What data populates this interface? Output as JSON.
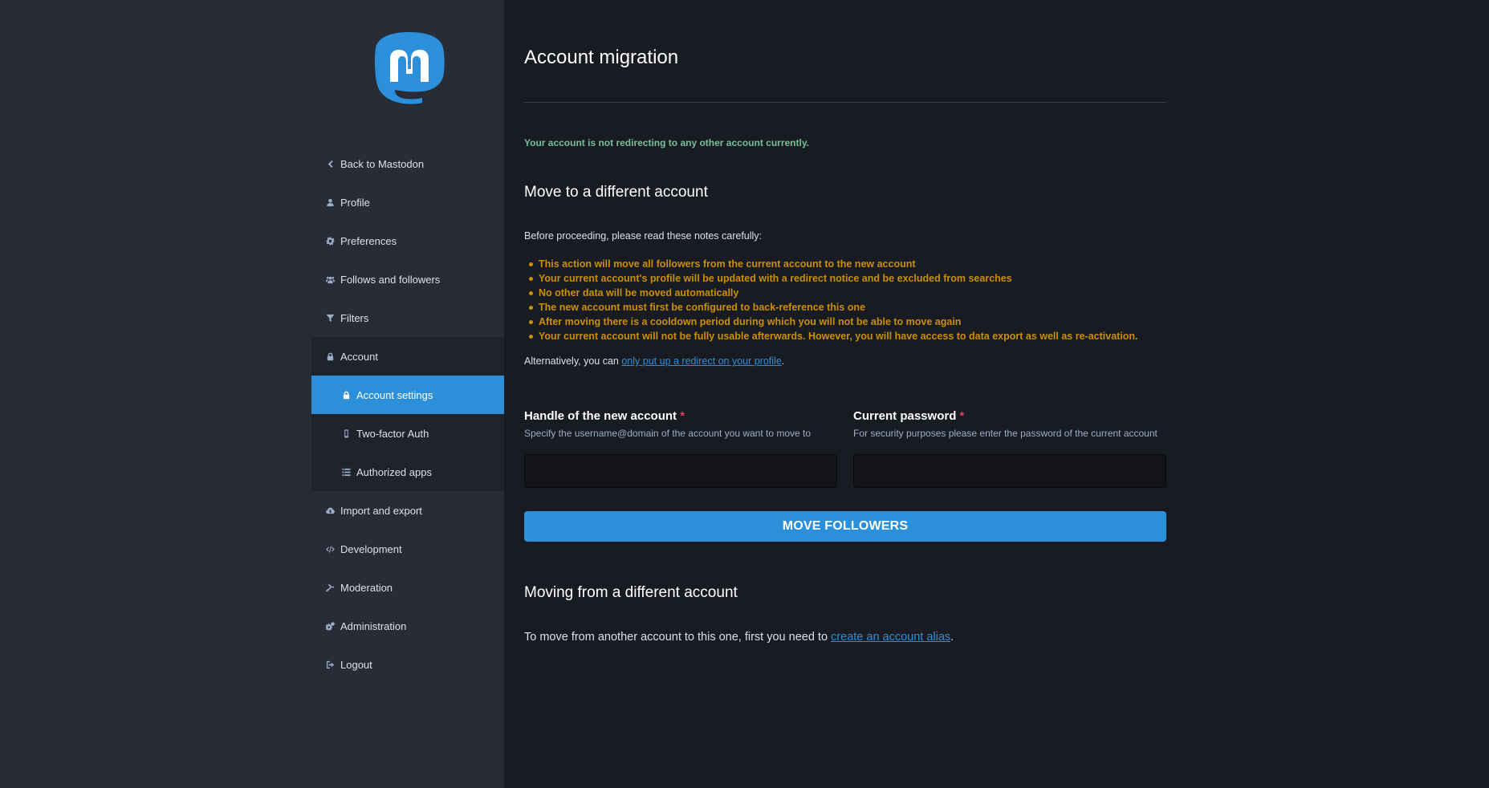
{
  "app": {
    "title": "Account migration",
    "colors": {
      "accent": "#2b90d9",
      "sidebar_bg": "#282c37",
      "content_bg": "#191b22",
      "success": "#79bd9a",
      "warning": "#ca8f04",
      "required": "#df405a"
    }
  },
  "sidebar": {
    "logo_icon": "mastodon-logo",
    "items": [
      {
        "label": "Back to Mastodon",
        "icon": "chevron-left-icon"
      },
      {
        "label": "Profile",
        "icon": "user-icon"
      },
      {
        "label": "Preferences",
        "icon": "gear-icon"
      },
      {
        "label": "Follows and followers",
        "icon": "users-icon"
      },
      {
        "label": "Filters",
        "icon": "filter-icon"
      },
      {
        "label": "Account",
        "icon": "lock-icon"
      },
      {
        "label": "Account settings",
        "icon": "lock-icon",
        "active": true
      },
      {
        "label": "Two-factor Auth",
        "icon": "mobile-icon"
      },
      {
        "label": "Authorized apps",
        "icon": "list-icon"
      },
      {
        "label": "Import and export",
        "icon": "cloud-download-icon"
      },
      {
        "label": "Development",
        "icon": "code-icon"
      },
      {
        "label": "Moderation",
        "icon": "gavel-icon"
      },
      {
        "label": "Administration",
        "icon": "cogs-icon"
      },
      {
        "label": "Logout",
        "icon": "sign-out-icon"
      }
    ]
  },
  "main": {
    "status_note": "Your account is not redirecting to any other account currently.",
    "move_section": {
      "heading": "Move to a different account",
      "intro": "Before proceeding, please read these notes carefully:",
      "notes": [
        "This action will move all followers from the current account to the new account",
        "Your current account's profile will be updated with a redirect notice and be excluded from searches",
        "No other data will be moved automatically",
        "The new account must first be configured to back-reference this one",
        "After moving there is a cooldown period during which you will not be able to move again",
        "Your current account will not be fully usable afterwards. However, you will have access to data export as well as re-activation."
      ],
      "alt_prefix": "Alternatively, you can ",
      "alt_link": "only put up a redirect on your profile",
      "alt_suffix": "."
    },
    "form": {
      "handle_label": "Handle of the new account",
      "handle_hint": "Specify the username@domain of the account you want to move to",
      "handle_value": "",
      "password_label": "Current password",
      "password_hint": "For security purposes please enter the password of the current account",
      "password_value": "",
      "required_mark": "*",
      "submit_label": "MOVE FOLLOWERS"
    },
    "from_section": {
      "heading": "Moving from a different account",
      "text_prefix": "To move from another account to this one, first you need to ",
      "link": "create an account alias",
      "text_suffix": "."
    }
  }
}
